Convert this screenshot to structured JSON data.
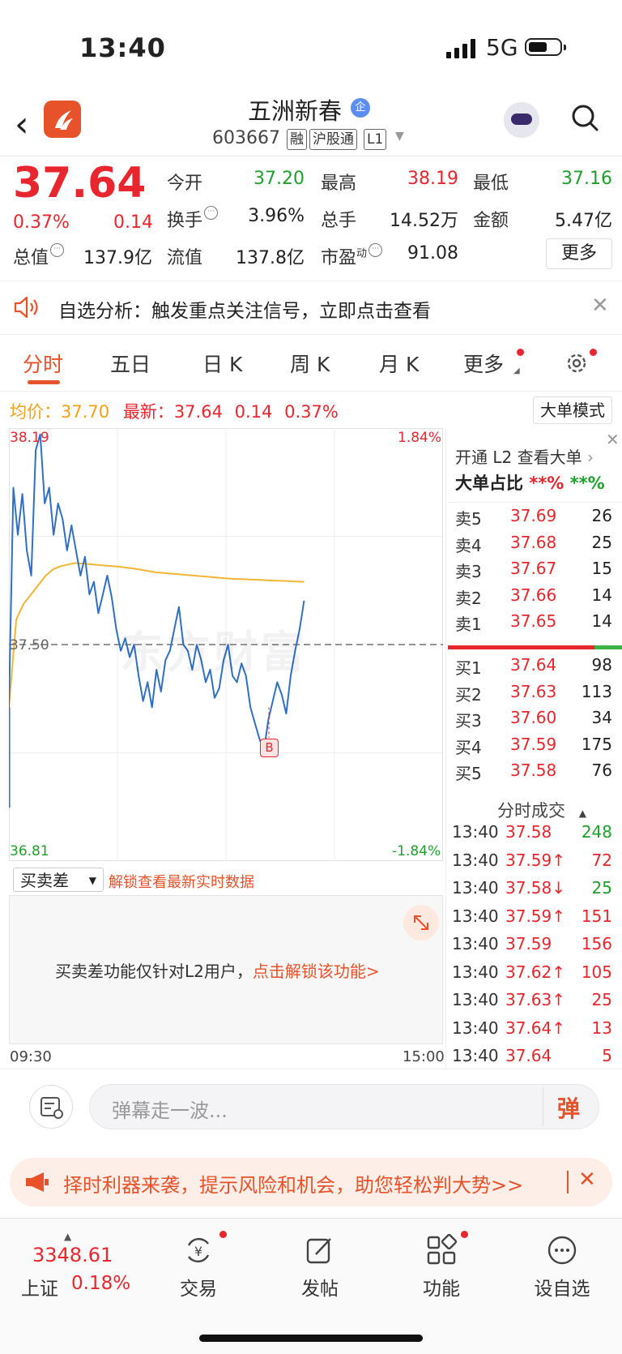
{
  "status_bar": {
    "time": "13:40",
    "network": "5G"
  },
  "header": {
    "stock_name": "五洲新春",
    "verified_badge": "企",
    "code": "603667",
    "tags": [
      "融",
      "沪股通",
      "L1"
    ]
  },
  "quote": {
    "price": "37.64",
    "change_pct": "0.37%",
    "change": "0.14",
    "fields": [
      {
        "label": "今开",
        "value": "37.20",
        "color": "green"
      },
      {
        "label": "最高",
        "value": "38.19",
        "color": "red"
      },
      {
        "label": "最低",
        "value": "37.16",
        "color": "green"
      },
      {
        "label": "换手",
        "value": "3.96%",
        "color": "black"
      },
      {
        "label": "总手",
        "value": "14.52万",
        "color": "black"
      },
      {
        "label": "金额",
        "value": "5.47亿",
        "color": "black"
      },
      {
        "label": "总值",
        "value": "137.9亿",
        "color": "black"
      },
      {
        "label": "流值",
        "value": "137.8亿",
        "color": "black"
      },
      {
        "label": "市盈",
        "value": "91.08",
        "color": "black",
        "sup": "动"
      }
    ],
    "more_button": "更多"
  },
  "notice": {
    "text": "自选分析：触发重点关注信号，立即点击查看"
  },
  "tabs": [
    "分时",
    "五日",
    "日 K",
    "周 K",
    "月 K",
    "更多"
  ],
  "chart_line": {
    "avg_label": "均价：",
    "avg_value": "37.70",
    "latest_label": "最新：",
    "latest_value": "37.64",
    "latest_change": "0.14",
    "latest_pct": "0.37%",
    "big_order_mode": "大单模式"
  },
  "chart_data": {
    "type": "line",
    "y_top_label": "38.19",
    "y_mid_label": "37.50",
    "y_bottom_label": "36.81",
    "pct_top_label": "1.84%",
    "pct_bottom_label": "-1.84%",
    "x_start_label": "09:30",
    "x_end_label": "15:00",
    "ylim": [
      36.81,
      38.19
    ],
    "prev_close": 37.5,
    "watermark": "东方财富",
    "buy_marker": "B",
    "price_series": [
      37.3,
      38.0,
      37.85,
      37.98,
      37.8,
      37.72,
      38.12,
      38.17,
      37.95,
      38.0,
      37.85,
      37.95,
      37.9,
      37.8,
      37.88,
      37.8,
      37.72,
      37.78,
      37.66,
      37.7,
      37.6,
      37.66,
      37.72,
      37.65,
      37.55,
      37.48,
      37.52,
      37.46,
      37.5,
      37.4,
      37.32,
      37.38,
      37.3,
      37.42,
      37.35,
      37.45,
      37.48,
      37.55,
      37.62,
      37.5,
      37.48,
      37.42,
      37.5,
      37.45,
      37.38,
      37.42,
      37.33,
      37.36,
      37.45,
      37.5,
      37.4,
      37.38,
      37.44,
      37.4,
      37.3,
      37.25,
      37.2,
      37.16,
      37.26,
      37.32,
      37.38,
      37.34,
      37.28,
      37.4,
      37.48,
      37.55,
      37.64
    ],
    "avg_series": [
      37.3,
      37.58,
      37.63,
      37.66,
      37.69,
      37.72,
      37.74,
      37.75,
      37.755,
      37.76,
      37.758,
      37.756,
      37.754,
      37.752,
      37.75,
      37.748,
      37.745,
      37.742,
      37.738,
      37.734,
      37.73,
      37.728,
      37.726,
      37.724,
      37.722,
      37.72,
      37.718,
      37.716,
      37.714,
      37.712,
      37.71,
      37.709,
      37.708,
      37.707,
      37.706,
      37.705,
      37.704,
      37.703,
      37.702,
      37.701,
      37.7
    ],
    "elapsed_fraction": 0.68
  },
  "orderbook": {
    "l2_link": "开通 L2 查看大单",
    "big_ratio_label": "大单占比",
    "big_ratio_red": "**%",
    "big_ratio_green": "**%",
    "asks": [
      {
        "label": "卖5",
        "price": "37.69",
        "vol": "26"
      },
      {
        "label": "卖4",
        "price": "37.68",
        "vol": "25"
      },
      {
        "label": "卖3",
        "price": "37.67",
        "vol": "15"
      },
      {
        "label": "卖2",
        "price": "37.66",
        "vol": "14"
      },
      {
        "label": "卖1",
        "price": "37.65",
        "vol": "14"
      }
    ],
    "bids": [
      {
        "label": "买1",
        "price": "37.64",
        "vol": "98"
      },
      {
        "label": "买2",
        "price": "37.63",
        "vol": "113"
      },
      {
        "label": "买3",
        "price": "37.60",
        "vol": "34"
      },
      {
        "label": "买4",
        "price": "37.59",
        "vol": "175"
      },
      {
        "label": "买5",
        "price": "37.58",
        "vol": "76"
      }
    ],
    "buy_ratio": 0.84
  },
  "trades": {
    "header": "分时成交",
    "rows": [
      {
        "time": "13:40",
        "price": "37.58",
        "arrow": "",
        "vol": "248",
        "vol_color": "green"
      },
      {
        "time": "13:40",
        "price": "37.59",
        "arrow": "↑",
        "vol": "72",
        "vol_color": "red"
      },
      {
        "time": "13:40",
        "price": "37.58",
        "arrow": "↓",
        "vol": "25",
        "vol_color": "green"
      },
      {
        "time": "13:40",
        "price": "37.59",
        "arrow": "↑",
        "vol": "151",
        "vol_color": "red"
      },
      {
        "time": "13:40",
        "price": "37.59",
        "arrow": "",
        "vol": "156",
        "vol_color": "red"
      },
      {
        "time": "13:40",
        "price": "37.62",
        "arrow": "↑",
        "vol": "105",
        "vol_color": "red"
      },
      {
        "time": "13:40",
        "price": "37.63",
        "arrow": "↑",
        "vol": "25",
        "vol_color": "red"
      },
      {
        "time": "13:40",
        "price": "37.64",
        "arrow": "↑",
        "vol": "13",
        "vol_color": "red"
      },
      {
        "time": "13:40",
        "price": "37.64",
        "arrow": "",
        "vol": "5",
        "vol_color": "red"
      }
    ]
  },
  "sub_chart": {
    "selector": "买卖差",
    "unlock_link": "解锁查看最新实时数据",
    "message": "买卖差功能仅针对L2用户，",
    "message_link": "点击解锁该功能>"
  },
  "comment": {
    "placeholder": "弹幕走一波...",
    "danmu_button": "弹"
  },
  "banner": {
    "text": "择时利器来袭，提示风险和机会，助您轻松判大势>>"
  },
  "bottom_nav": {
    "index_value": "3348.61",
    "index_name": "上证",
    "index_pct": "0.18%",
    "items": [
      {
        "label": "交易",
        "icon": "yen-cycle-icon",
        "dot": true
      },
      {
        "label": "发帖",
        "icon": "edit-icon",
        "dot": false
      },
      {
        "label": "功能",
        "icon": "grid-icon",
        "dot": true
      },
      {
        "label": "设自选",
        "icon": "more-circle-icon",
        "dot": false
      }
    ]
  },
  "colors": {
    "red": "#e8262d",
    "green": "#1fa02c",
    "orange": "#e8522a",
    "price_line": "#2f6fc4",
    "avg_line": "#f2b534"
  }
}
